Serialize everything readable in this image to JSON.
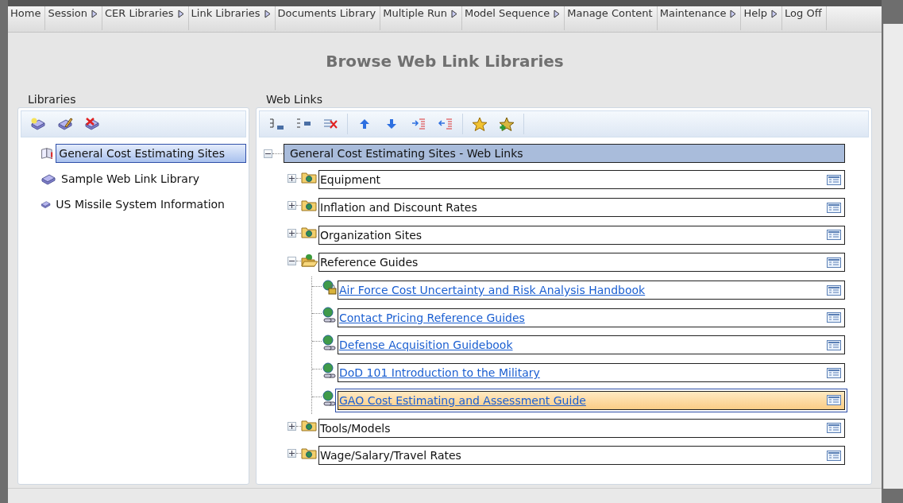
{
  "menu": [
    {
      "label": "Home",
      "has_submenu": false
    },
    {
      "label": "Session",
      "has_submenu": true
    },
    {
      "label": "CER Libraries",
      "has_submenu": true
    },
    {
      "label": "Link Libraries",
      "has_submenu": true
    },
    {
      "label": "Documents Library",
      "has_submenu": false
    },
    {
      "label": "Multiple Run",
      "has_submenu": true
    },
    {
      "label": "Model Sequence",
      "has_submenu": true
    },
    {
      "label": "Manage Content",
      "has_submenu": false
    },
    {
      "label": "Maintenance",
      "has_submenu": true
    },
    {
      "label": "Help",
      "has_submenu": true
    },
    {
      "label": "Log Off",
      "has_submenu": false
    }
  ],
  "page_title": "Browse Web Link Libraries",
  "libraries": {
    "title": "Libraries",
    "items": [
      {
        "label": "General Cost Estimating Sites",
        "selected": true
      },
      {
        "label": "Sample Web Link Library",
        "selected": false
      },
      {
        "label": "US Missile System Information",
        "selected": false
      }
    ]
  },
  "web_links": {
    "title": "Web Links",
    "tree": {
      "label": "General Cost Estimating Sites - Web Links",
      "expanded": true,
      "children": [
        {
          "kind": "folder",
          "label": "Equipment",
          "expanded": false
        },
        {
          "kind": "folder",
          "label": "Inflation and Discount Rates",
          "expanded": false
        },
        {
          "kind": "folder",
          "label": "Organization Sites",
          "expanded": false
        },
        {
          "kind": "folder",
          "label": "Reference Guides",
          "expanded": true,
          "children": [
            {
              "kind": "link",
              "label": "Air Force Cost Uncertainty and Risk Analysis Handbook",
              "locked": true,
              "selected": false
            },
            {
              "kind": "link",
              "label": "Contact Pricing Reference Guides",
              "locked": false,
              "selected": false
            },
            {
              "kind": "link",
              "label": "Defense Acquisition Guidebook",
              "locked": false,
              "selected": false
            },
            {
              "kind": "link",
              "label": "DoD 101 Introduction to the Military",
              "locked": false,
              "selected": false
            },
            {
              "kind": "link",
              "label": "GAO Cost Estimating and Assessment Guide",
              "locked": false,
              "selected": true
            }
          ]
        },
        {
          "kind": "folder",
          "label": "Tools/Models",
          "expanded": false
        },
        {
          "kind": "folder",
          "label": "Wage/Salary/Travel Rates",
          "expanded": false
        }
      ]
    }
  }
}
